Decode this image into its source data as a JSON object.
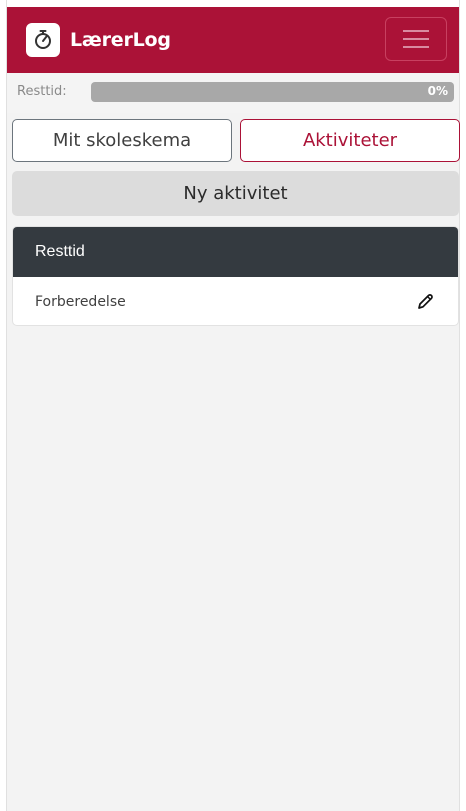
{
  "app": {
    "title": "LærerLog",
    "logo_icon": "stopwatch-icon",
    "menu_icon": "hamburger-icon"
  },
  "status": {
    "label": "Resttid:",
    "progress_percent": 0,
    "progress_text": "0%"
  },
  "tabs": [
    {
      "label": "Mit skoleskema",
      "active": false
    },
    {
      "label": "Aktiviteter",
      "active": true
    }
  ],
  "actions": {
    "new_activity_label": "Ny aktivitet"
  },
  "activity_list": {
    "header": "Resttid",
    "items": [
      {
        "name": "Forberedelse",
        "action_icon": "pencil-icon"
      }
    ]
  },
  "colors": {
    "brand": "#ab1237",
    "dark_header": "#343a40",
    "progress_track": "#a8a8a8",
    "content_bg": "#f3f3f3"
  }
}
